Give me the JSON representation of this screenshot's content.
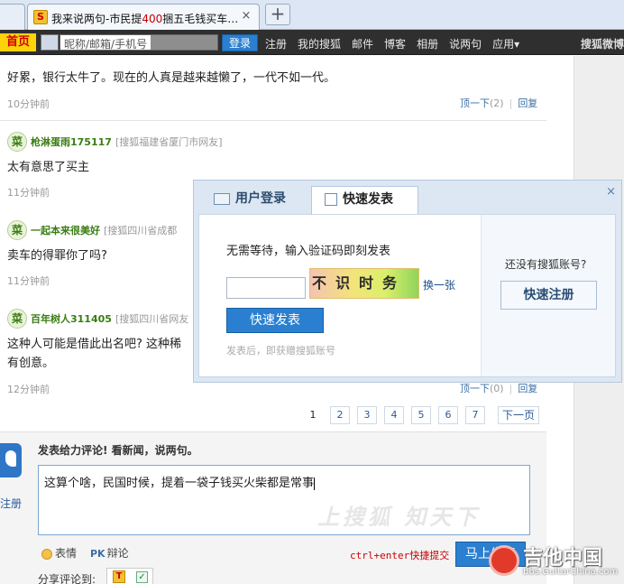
{
  "browser": {
    "tab_title_prefix": "我来说两句-市民提",
    "tab_title_num": "400",
    "tab_title_suffix": "捆五毛钱买车…",
    "tab_close": "×",
    "new_tab": "+"
  },
  "nav": {
    "home": "首页",
    "login_placeholder": "昵称/邮箱/手机号",
    "login_button": "登录",
    "links": [
      "注册",
      "我的搜狐",
      "邮件",
      "博客",
      "相册",
      "说两句",
      "应用▾"
    ],
    "brand": "搜狐微博"
  },
  "comments": [
    {
      "text": "好累，银行太牛了。现在的人真是越来越懒了，一代不如一代。",
      "time": "10分钟前",
      "up_label": "顶一下",
      "up_count": "(2)",
      "reply_label": "回复"
    },
    {
      "badge": "菜",
      "user": "枪淋蛋雨175117",
      "location": "[搜狐福建省厦门市网友]",
      "text": "太有意思了买主",
      "time": "11分钟前"
    },
    {
      "badge": "菜",
      "user": "一起本来很美好",
      "location": "[搜狐四川省成都",
      "text": "卖车的得罪你了吗?",
      "time": "11分钟前"
    },
    {
      "badge": "菜",
      "user": "百年树人311405",
      "location": "[搜狐四川省网友",
      "text_line1": "这种人可能是借此出名吧? 这种稀",
      "text_line2": "有创意。",
      "time": "12分钟前",
      "up_label": "顶一下",
      "up_count": "(0)",
      "reply_label": "回复"
    }
  ],
  "pager": {
    "pages": [
      "1",
      "2",
      "3",
      "4",
      "5",
      "6",
      "7"
    ],
    "next": "下一页"
  },
  "composer": {
    "title": "发表给力评论! 看新闻，说两句。",
    "register": "注册",
    "content": "这算个啥，民国时候，提着一袋子钱买火柴都是常事",
    "watermark": "上搜狐 知天下",
    "emoji": "表情",
    "pk_icon": "PK",
    "debate": "辩论",
    "hotkey": "ctrl+enter快捷提交",
    "submit": "马上发表",
    "share_label": "分享评论到:"
  },
  "popup": {
    "close": "×",
    "tab_login": "用户登录",
    "tab_fast": "快速发表",
    "message": "无需等待，输入验证码即刻发表",
    "captcha_text": "不识时务",
    "captcha_refresh": "换一张",
    "fast_post_button": "快速发表",
    "note": "发表后，即获赠搜狐账号",
    "no_account": "还没有搜狐账号?",
    "quick_register": "快速注册"
  },
  "site_watermark": {
    "big": "吉他中国",
    "small": "bbs.GuitarChina.com"
  }
}
